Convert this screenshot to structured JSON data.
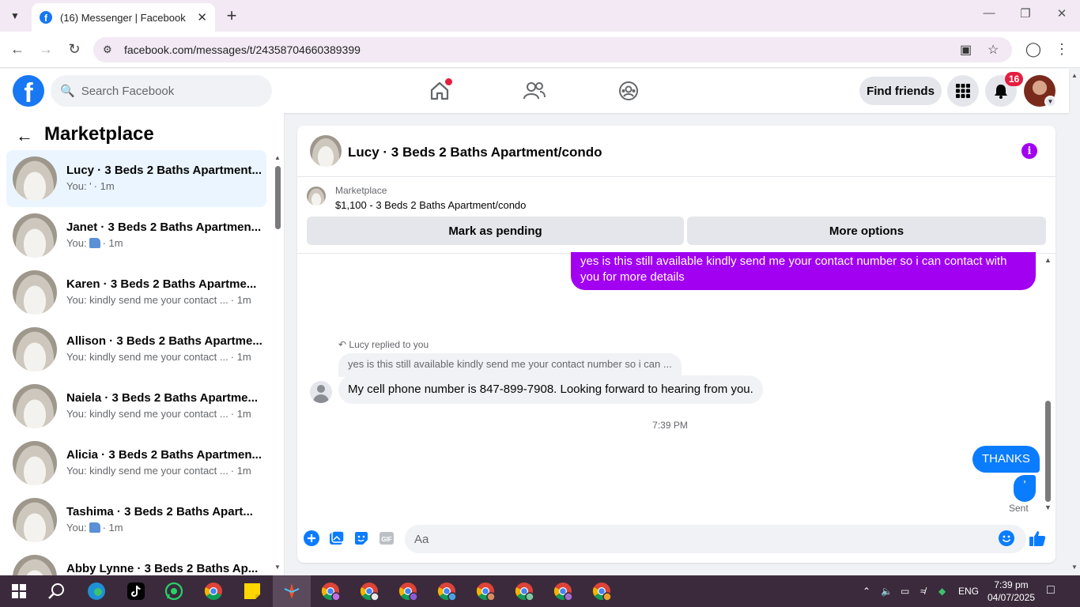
{
  "browser": {
    "tab_title": "(16) Messenger | Facebook",
    "tab_favicon": "f",
    "url": "facebook.com/messages/t/24358704660389399"
  },
  "fb_header": {
    "logo": "f",
    "search_placeholder": "Search Facebook",
    "find_friends_label": "Find friends",
    "notification_count": "16"
  },
  "sidebar": {
    "title": "Marketplace",
    "conversations": [
      {
        "name": "Lucy · 3 Beds 2 Baths Apartment...",
        "preview": "You: '",
        "time": "· 1m",
        "active": true
      },
      {
        "name": "Janet · 3 Beds 2 Baths Apartmen...",
        "preview": "You:",
        "time": "· 1m",
        "has_like": true
      },
      {
        "name": "Karen · 3 Beds 2 Baths Apartme...",
        "preview": "You: kindly send me your contact ...",
        "time": "· 1m"
      },
      {
        "name": "Allison · 3 Beds 2 Baths Apartme...",
        "preview": "You: kindly send me your contact ...",
        "time": "· 1m"
      },
      {
        "name": "Naiela · 3 Beds 2 Baths Apartme...",
        "preview": "You: kindly send me your contact ...",
        "time": "· 1m"
      },
      {
        "name": "Alicia · 3 Beds 2 Baths Apartmen...",
        "preview": "You: kindly send me your contact ...",
        "time": "· 1m"
      },
      {
        "name": "Tashima · 3 Beds 2 Baths Apart...",
        "preview": "You:",
        "time": "· 1m",
        "has_like": true
      },
      {
        "name": "Abby Lynne · 3 Beds 2 Baths Ap...",
        "preview": "",
        "time": ""
      }
    ]
  },
  "chat": {
    "title": "Lucy · 3 Beds 2 Baths Apartment/condo",
    "marketplace_label": "Marketplace",
    "listing": "$1,100 - 3 Beds 2 Baths Apartment/condo",
    "mark_pending_label": "Mark as pending",
    "more_options_label": "More options",
    "messages": {
      "outgoing_1": "yes is this still available kindly send me your contact number so i can contact with you for more details",
      "replied_to_label": "Lucy replied to you",
      "quoted_text": "yes is this still available kindly send me your contact number so i can ...",
      "incoming_1": "My cell phone number is 847-899-7908. Looking forward to hearing from you.",
      "timestamp": "7:39 PM",
      "outgoing_2": "THANKS",
      "outgoing_3": "'",
      "status": "Sent"
    },
    "composer_placeholder": "Aa"
  },
  "taskbar": {
    "language": "ENG",
    "time": "7:39 pm",
    "date": "04/07/2025"
  },
  "colors": {
    "fb_blue": "#1877f2",
    "messenger_blue": "#0a7cff",
    "purple_bubble": "#a200f0",
    "notification_red": "#e41e3f"
  }
}
